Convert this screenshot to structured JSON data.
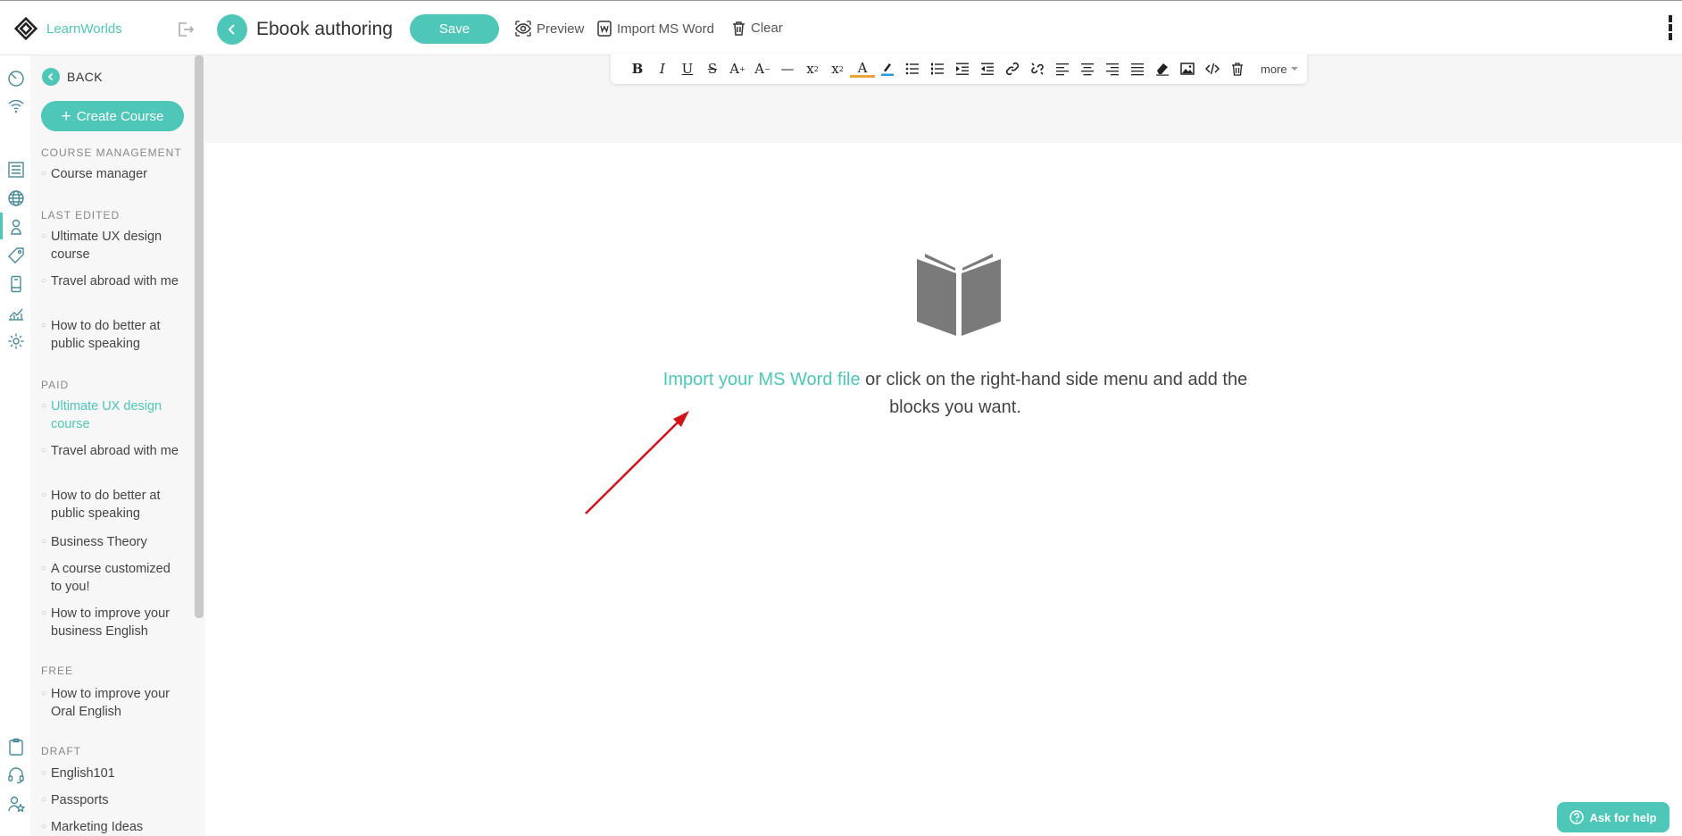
{
  "app": {
    "brand": "LearnWorlds"
  },
  "header": {
    "title": "Ebook authoring",
    "save_label": "Save",
    "preview_label": "Preview",
    "import_label": "Import MS Word",
    "clear_label": "Clear"
  },
  "sidebar": {
    "back_label": "BACK",
    "create_label": "Create Course",
    "sections": {
      "management": {
        "title": "COURSE MANAGEMENT",
        "items": [
          "Course manager"
        ]
      },
      "last_edited": {
        "title": "LAST EDITED",
        "items": [
          "Ultimate UX design course",
          "Travel abroad with me",
          "How to do better at public speaking"
        ]
      },
      "paid": {
        "title": "PAID",
        "items": [
          "Ultimate UX design course",
          "Travel abroad with me",
          "How to do better at public speaking",
          "Business Theory",
          "A course customized to you!",
          "How to improve your business English"
        ]
      },
      "free": {
        "title": "FREE",
        "items": [
          "How to improve your Oral English"
        ]
      },
      "draft": {
        "title": "DRAFT",
        "items": [
          "English101",
          "Passports",
          "Marketing Ideas"
        ]
      }
    }
  },
  "toolbar": {
    "more_label": "more"
  },
  "empty_state": {
    "link_text": "Import your MS Word file",
    "rest_text": " or click on the right-hand side menu and add the blocks you want."
  },
  "help": {
    "label": "Ask for help"
  },
  "colors": {
    "accent": "#4ec6b8",
    "arrow": "#d0121b"
  }
}
